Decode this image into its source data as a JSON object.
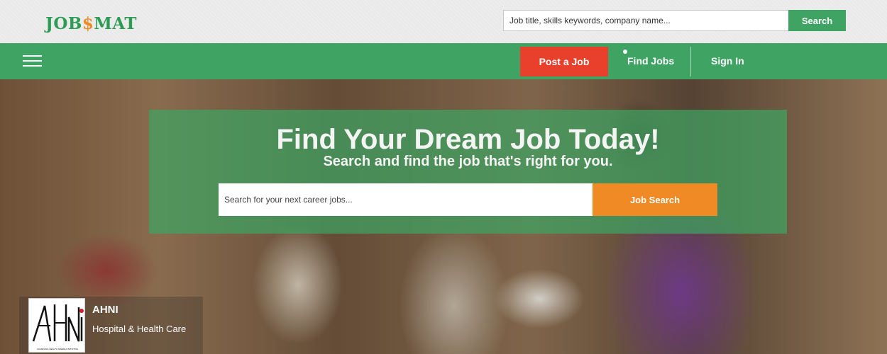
{
  "header": {
    "logo_prefix": "JOB",
    "logo_symbol": "$",
    "logo_suffix": "MAT",
    "search_placeholder": "Job title, skills keywords, company name...",
    "search_button": "Search"
  },
  "nav": {
    "post_job": "Post a Job",
    "find_jobs": "Find Jobs",
    "sign_in": "Sign In"
  },
  "hero": {
    "title": "Find Your Dream Job Today!",
    "subtitle": "Search and find the job that's right for you.",
    "search_placeholder": "Search for your next career jobs...",
    "search_button": "Job Search"
  },
  "featured_employer": {
    "name": "AHNI",
    "industry": "Hospital & Health Care",
    "logo_text": "AHNI",
    "logo_caption": "ACHIEVING HEALTH NIGERIA INITIATIVE"
  },
  "colors": {
    "brand_green": "#3fa463",
    "accent_orange": "#ef8a24",
    "post_job_red": "#e8402b"
  },
  "icons": [
    "hamburger-menu-icon",
    "dot-indicator-icon"
  ]
}
